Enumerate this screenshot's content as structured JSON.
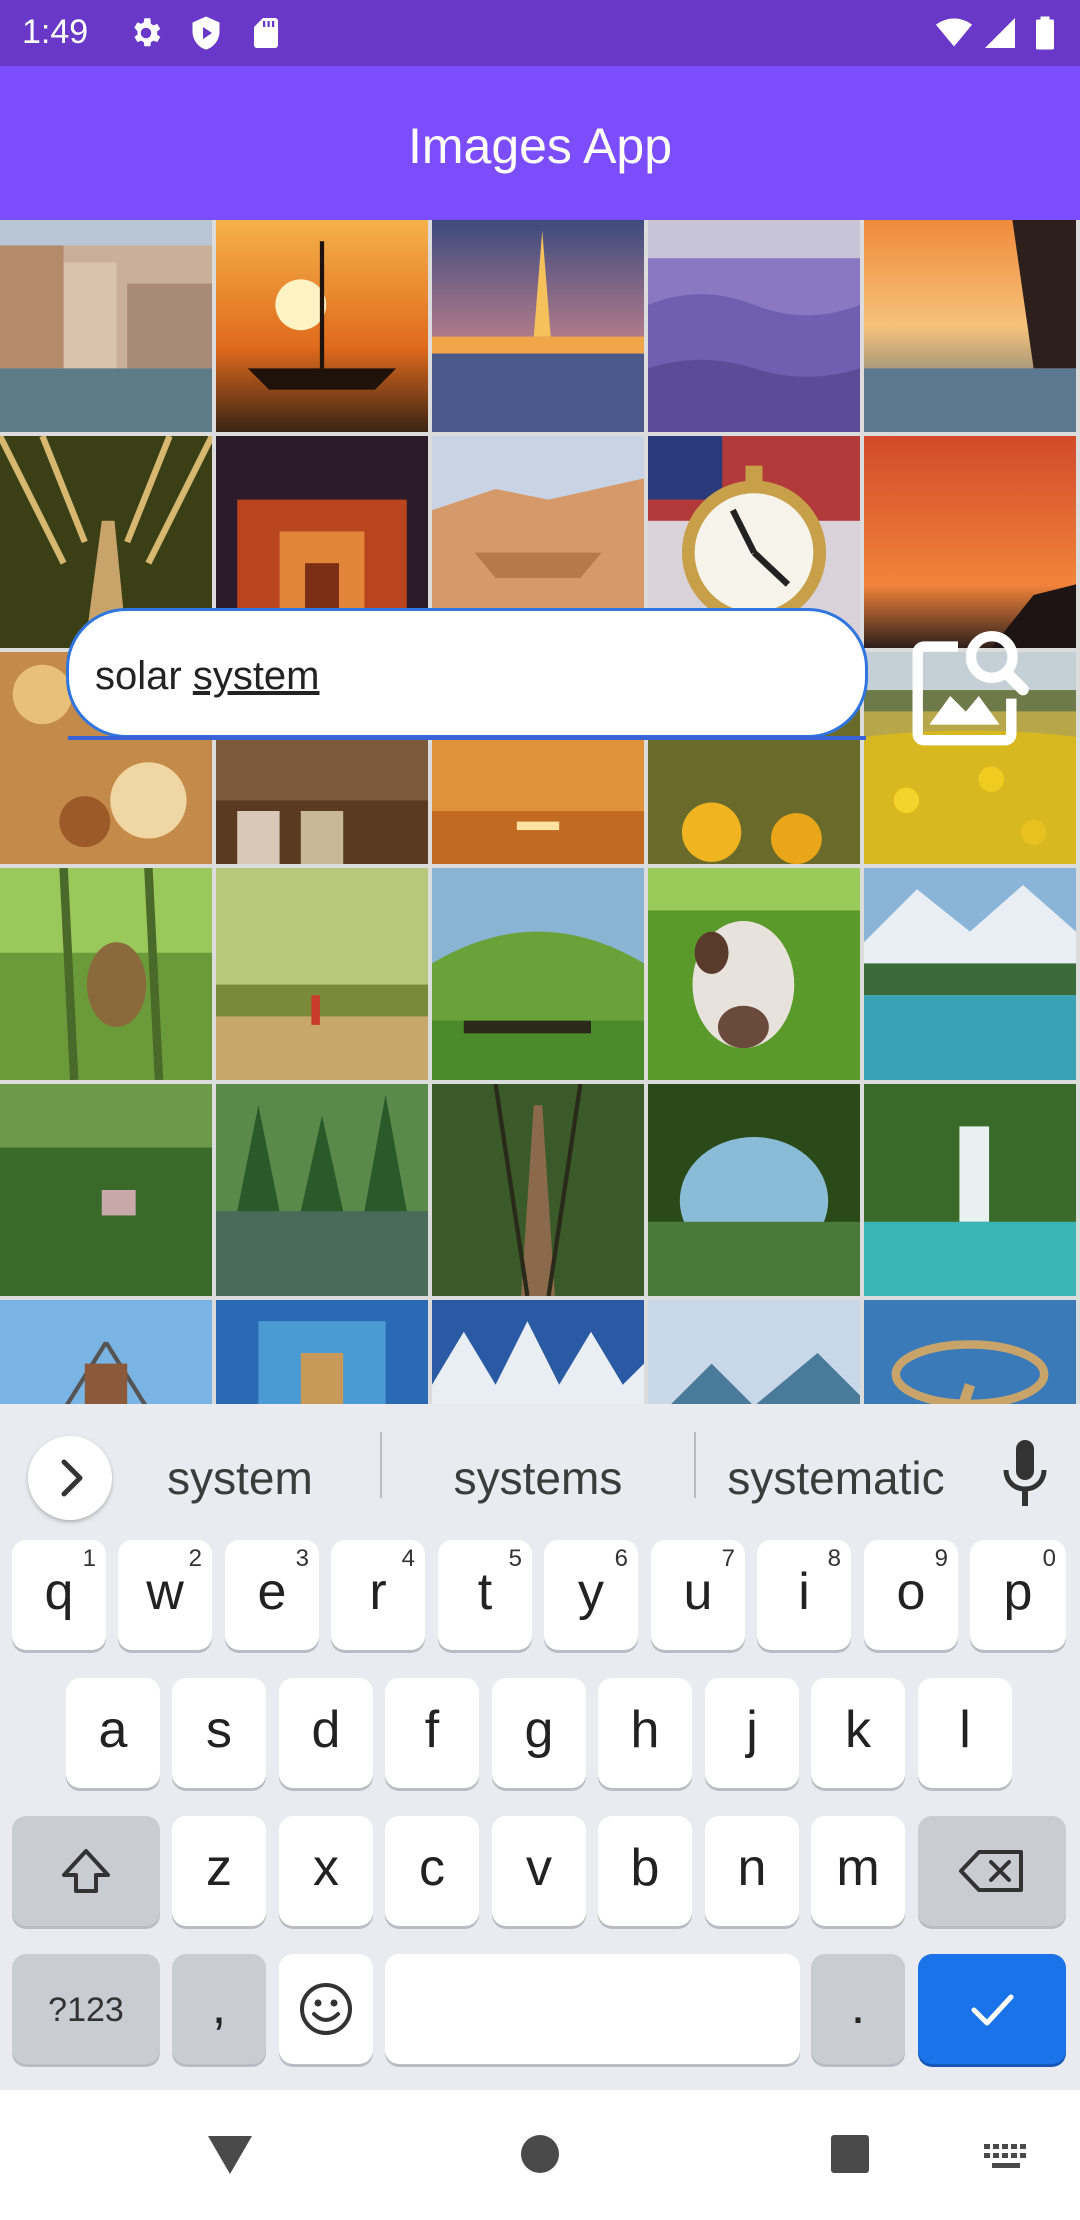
{
  "status_bar": {
    "time": "1:49",
    "icons": [
      "settings-icon",
      "shield-icon",
      "sd-card-icon",
      "wifi-icon",
      "signal-icon",
      "battery-icon"
    ]
  },
  "app_bar": {
    "title": "Images App"
  },
  "search": {
    "value": "solar system",
    "value_plain": "solar ",
    "value_composing": "system",
    "accent_color": "#2f75e0",
    "button_icon": "image-search-icon"
  },
  "grid": {
    "columns": 5,
    "rows": 6,
    "visible_tiles": 30,
    "tile_subjects": [
      "venice-canal",
      "sunset-boat",
      "paris-eiffel-night",
      "lavender-field",
      "sunset-sea-cliff",
      "tree-tunnel-road",
      "petra-treasury",
      "desert-rocks",
      "flag-clock",
      "red-sunset-coast",
      "autumn-leaves",
      "market-stall",
      "sunset-water",
      "sunflowers",
      "yellow-wildflowers",
      "monkey-jungle",
      "forest-path-sunlight",
      "green-hill-cattle",
      "cow-closeup",
      "alpine-lake",
      "rainforest-house",
      "lake-forest",
      "rope-bridge",
      "tree-frame-river",
      "jungle-waterfall",
      "brooklyn-bridge",
      "blue-tile-building",
      "snowy-forest",
      "fjord-lake",
      "blue-spiral"
    ]
  },
  "keyboard": {
    "suggestions": [
      "system",
      "systems",
      "systematic"
    ],
    "row1": [
      {
        "k": "q",
        "h": "1"
      },
      {
        "k": "w",
        "h": "2"
      },
      {
        "k": "e",
        "h": "3"
      },
      {
        "k": "r",
        "h": "4"
      },
      {
        "k": "t",
        "h": "5"
      },
      {
        "k": "y",
        "h": "6"
      },
      {
        "k": "u",
        "h": "7"
      },
      {
        "k": "i",
        "h": "8"
      },
      {
        "k": "o",
        "h": "9"
      },
      {
        "k": "p",
        "h": "0"
      }
    ],
    "row2": [
      "a",
      "s",
      "d",
      "f",
      "g",
      "h",
      "j",
      "k",
      "l"
    ],
    "row3": [
      "z",
      "x",
      "c",
      "v",
      "b",
      "n",
      "m"
    ],
    "symbols_label": "?123",
    "comma_label": ",",
    "period_label": ".",
    "enter_color": "#1a73e8"
  },
  "nav_bar": {
    "icons": [
      "back-icon",
      "home-icon",
      "recents-icon",
      "keyboard-switch-icon"
    ]
  },
  "colors": {
    "status_bar": "#6a38c8",
    "app_bar": "#7c4dfd",
    "keyboard_bg": "#e9ebf0"
  }
}
